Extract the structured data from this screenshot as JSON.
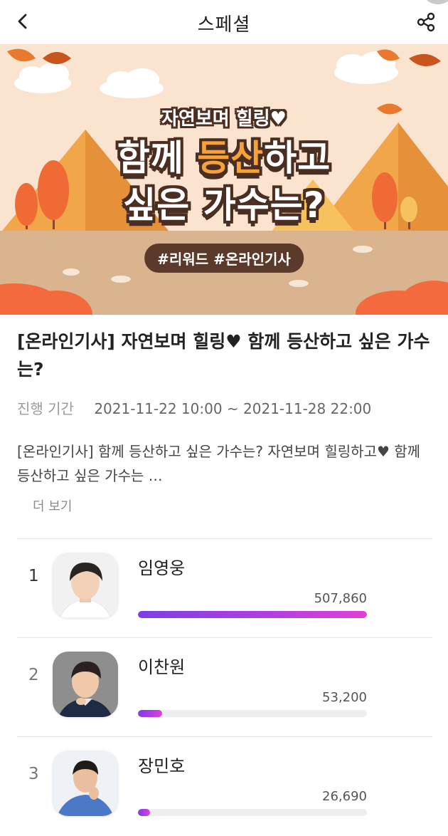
{
  "header": {
    "title": "스페셜",
    "back_icon": "chevron-left-icon",
    "share_icon": "share-icon"
  },
  "banner": {
    "subtitle": "자연보며 힐링♥",
    "line1_pre": "함께 ",
    "line1_highlight": "등산",
    "line1_post": "하고",
    "line2": "싶은 가수는?",
    "tags": "#리워드 #온라인기사",
    "colors": {
      "sky": "#fbe4cf",
      "mountain": "#f2a64a",
      "ground": "#d9b48f",
      "bush": "#f26a3d",
      "outline": "#4a2e22"
    }
  },
  "article": {
    "title": "[온라인기사] 자연보며 힐링♥ 함께 등산하고 싶은 가수는?",
    "period_label": "진행 기간",
    "period_value": "2021-11-22 10:00 ~ 2021-11-28 22:00",
    "description": "[온라인기사] 함께 등산하고 싶은 가수는? 자연보며 힐링하고♥ 함께 등산하고 싶은 가수는 …",
    "more_label": "더 보기"
  },
  "ranking": [
    {
      "rank": "1",
      "name": "임영웅",
      "count": "507,860",
      "ratio": 1.0
    },
    {
      "rank": "2",
      "name": "이찬원",
      "count": "53,200",
      "ratio": 0.105
    },
    {
      "rank": "3",
      "name": "장민호",
      "count": "26,690",
      "ratio": 0.053
    }
  ],
  "bar_gradient": [
    "#7b3fe4",
    "#b13ee0",
    "#e040d6"
  ]
}
